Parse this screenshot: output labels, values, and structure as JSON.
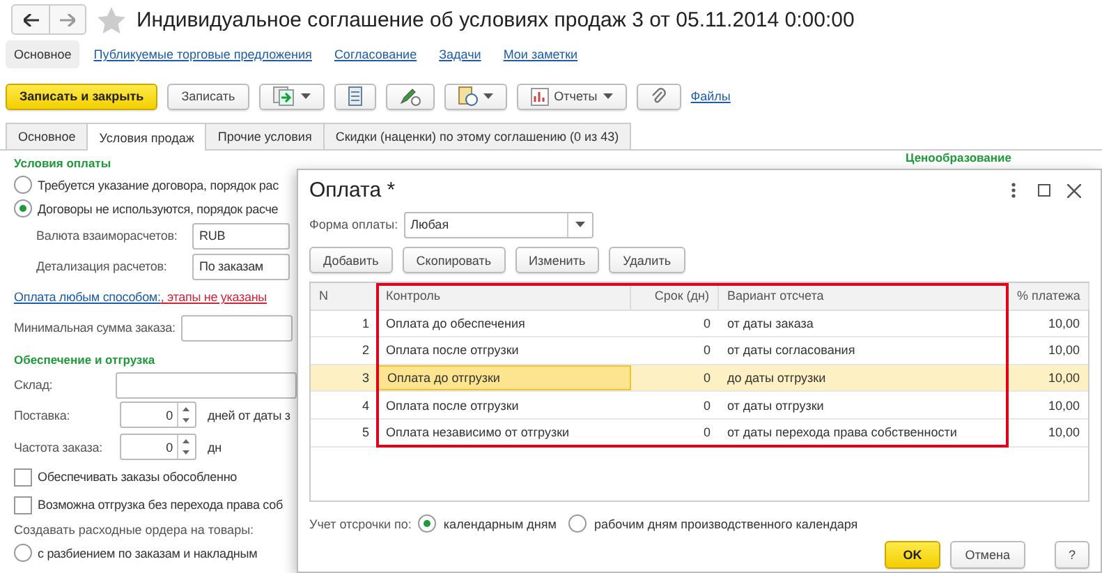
{
  "window": {
    "title": "Индивидуальное соглашение об условиях продаж 3 от 05.11.2014 0:00:00"
  },
  "nav": [
    {
      "label": "Основное",
      "selected": true
    },
    {
      "label": "Публикуемые торговые предложения",
      "selected": false
    },
    {
      "label": "Согласование",
      "selected": false
    },
    {
      "label": "Задачи",
      "selected": false
    },
    {
      "label": "Мои заметки",
      "selected": false
    }
  ],
  "toolbar": {
    "save_close": "Записать и закрыть",
    "save": "Записать",
    "reports": "Отчеты",
    "files": "Файлы"
  },
  "tabs": [
    {
      "label": "Основное",
      "selected": false
    },
    {
      "label": "Условия продаж",
      "selected": true
    },
    {
      "label": "Прочие условия",
      "selected": false
    },
    {
      "label": "Скидки (наценки) по этому соглашению (0 из 43)",
      "selected": false
    }
  ],
  "payment_terms": {
    "heading": "Условия оплаты",
    "options": [
      {
        "label": "Требуется указание договора, порядок рас",
        "selected": false
      },
      {
        "label": "Договоры не используются, порядок расче",
        "selected": true
      }
    ],
    "currency": {
      "label": "Валюта взаиморасчетов:",
      "value": "RUB"
    },
    "detail": {
      "label": "Детализация расчетов:",
      "value": "По заказам"
    },
    "payment_link": "Оплата любым способом:",
    "stages_link": ", этапы не указаны",
    "min_sum_label": "Минимальная сумма заказа:"
  },
  "supply": {
    "heading": "Обеспечение и отгрузка",
    "warehouse_label": "Склад:",
    "delivery": {
      "label": "Поставка:",
      "value": "0",
      "suffix": "дней от даты з"
    },
    "frequency": {
      "label": "Частота заказа:",
      "value": "0",
      "suffix": "дн"
    },
    "checks": [
      {
        "label": "Обеспечивать заказы обособленно",
        "checked": false
      },
      {
        "label": "Возможна отгрузка без перехода права соб",
        "checked": false
      }
    ],
    "orders_label": "Создавать расходные ордера на товары:",
    "order_options": [
      {
        "label": "с разбиением по заказам и накладным",
        "selected": false
      }
    ]
  },
  "pricing_heading": "Ценообразование",
  "dialog": {
    "title": "Оплата *",
    "form": {
      "label": "Форма оплаты:",
      "value": "Любая"
    },
    "buttons": [
      "Добавить",
      "Скопировать",
      "Изменить",
      "Удалить"
    ],
    "table": {
      "columns": [
        "N",
        "Контроль",
        "Срок (дн)",
        "Вариант отсчета",
        "% платежа"
      ],
      "rows": [
        {
          "cells": [
            "1",
            "Оплата до обеспечения",
            "0",
            "от даты заказа",
            "10,00"
          ],
          "selected": false
        },
        {
          "cells": [
            "2",
            "Оплата после отгрузки",
            "0",
            "от даты согласования",
            "10,00"
          ],
          "selected": false
        },
        {
          "cells": [
            "3",
            "Оплата до отгрузки",
            "0",
            "до даты отгрузки",
            "10,00"
          ],
          "selected": true
        },
        {
          "cells": [
            "4",
            "Оплата после отгрузки",
            "0",
            "от даты отгрузки",
            "10,00"
          ],
          "selected": false
        },
        {
          "cells": [
            "5",
            "Оплата независимо от отгрузки",
            "0",
            "от даты перехода права собственности",
            "10,00"
          ],
          "selected": false
        }
      ]
    },
    "deferral": {
      "label": "Учет отсрочки по:",
      "options": [
        {
          "label": "календарным дням",
          "selected": true
        },
        {
          "label": "рабочим дням производственного календаря",
          "selected": false
        }
      ]
    },
    "ok": "OK",
    "cancel": "Отмена",
    "help": "?"
  }
}
